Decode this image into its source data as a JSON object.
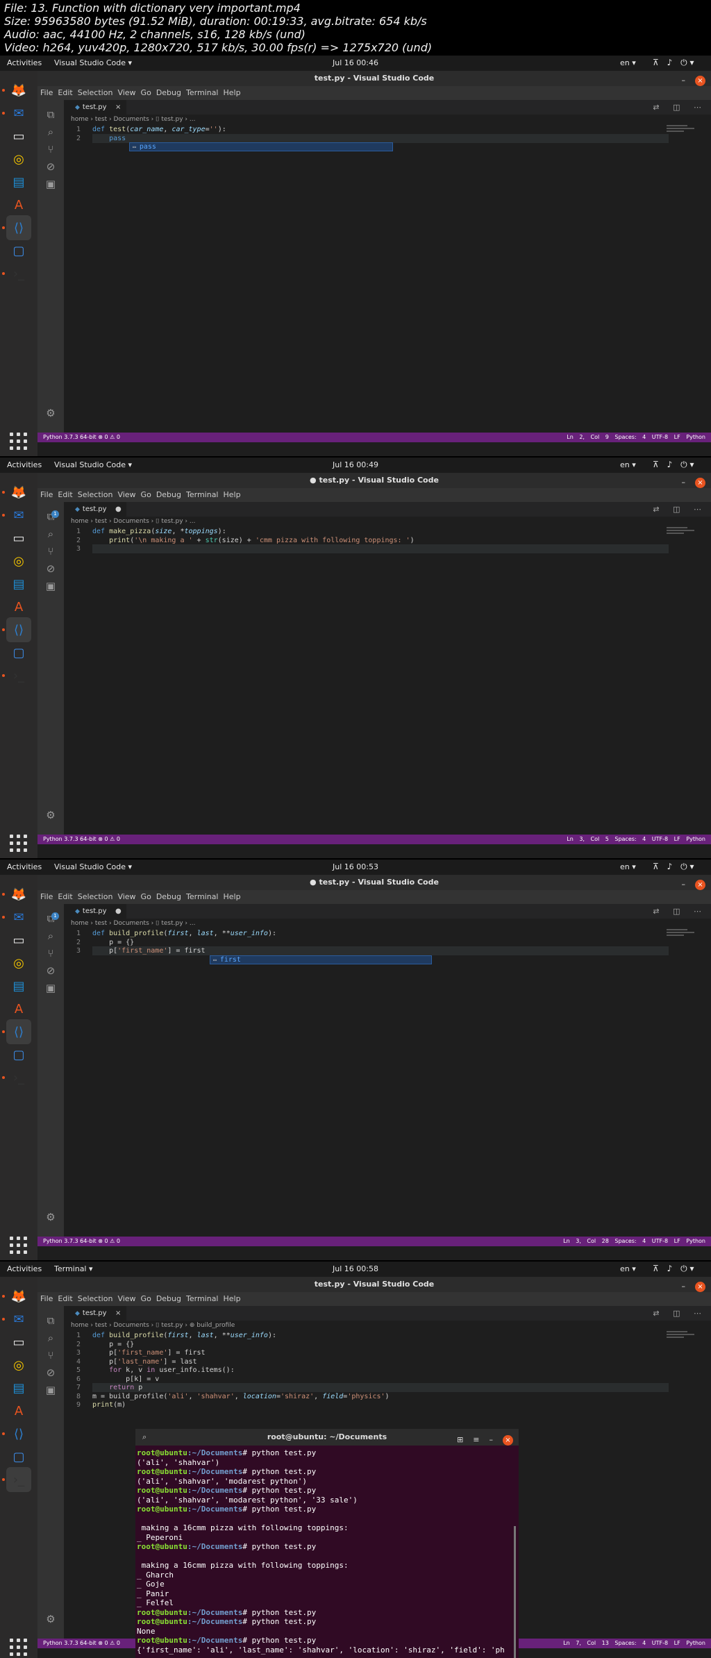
{
  "file_info": [
    "File: 13. Function with dictionary very important.mp4",
    "Size: 95963580 bytes (91.52 MiB), duration: 00:19:33, avg.bitrate: 654 kb/s",
    "Audio: aac, 44100 Hz, 2 channels, s16, 128 kb/s (und)",
    "Video: h264, yuv420p, 1280x720, 517 kb/s, 30.00 fps(r) => 1275x720 (und)"
  ],
  "colors": {
    "accent": "#e95420",
    "statusbar": "#68217a",
    "terminal_bg": "#300a24"
  },
  "menu": [
    "File",
    "Edit",
    "Selection",
    "View",
    "Go",
    "Debug",
    "Terminal",
    "Help"
  ],
  "frames": [
    {
      "activities": "Activities",
      "app": "Visual Studio Code ▾",
      "clock": "Jul 16 00:46",
      "lang": "en ▾",
      "window_title": "test.py - Visual Studio Code",
      "tab": "test.py",
      "tab_mark": "×",
      "breadcrumb": "home › test › Documents › ⌷ test.py › ...",
      "lines": [
        {
          "n": "1",
          "segs": [
            [
              "kw",
              "def "
            ],
            [
              "fn",
              "test"
            ],
            [
              "",
              "("
            ],
            [
              "pm",
              "car_name"
            ],
            [
              "",
              ", "
            ],
            [
              "pm",
              "car_type"
            ],
            [
              "",
              "="
            ],
            [
              "st",
              "''"
            ],
            [
              "",
              "):"
            ]
          ]
        },
        {
          "n": "2",
          "segs": [
            [
              "",
              "    "
            ],
            [
              "kw",
              "pass"
            ]
          ]
        }
      ],
      "suggest": "pass",
      "status_left": "Python 3.7.3 64-bit   ⊗ 0 ⚠ 0",
      "status_right": "Ln 2, Col 9   Spaces: 4   UTF-8   LF   Python"
    },
    {
      "activities": "Activities",
      "app": "Visual Studio Code ▾",
      "clock": "Jul 16 00:49",
      "lang": "en ▾",
      "window_title": "● test.py - Visual Studio Code",
      "tab": "test.py",
      "tab_mark": "●",
      "breadcrumb": "home › test › Documents › ⌷ test.py › ...",
      "lines": [
        {
          "n": "1",
          "segs": [
            [
              "kw",
              "def "
            ],
            [
              "fn",
              "make_pizza"
            ],
            [
              "",
              "("
            ],
            [
              "pm",
              "size"
            ],
            [
              "",
              ", *"
            ],
            [
              "pm",
              "toppings"
            ],
            [
              "",
              "):"
            ]
          ]
        },
        {
          "n": "2",
          "segs": [
            [
              "",
              "    "
            ],
            [
              "fn",
              "print"
            ],
            [
              "",
              "("
            ],
            [
              "st",
              "'\\n making a '"
            ],
            [
              "",
              " + "
            ],
            [
              "bi",
              "str"
            ],
            [
              "",
              "(size) + "
            ],
            [
              "st",
              "'cmm pizza with following toppings: '"
            ],
            [
              "",
              ")"
            ]
          ]
        },
        {
          "n": "3",
          "segs": [
            [
              "",
              ""
            ]
          ]
        }
      ],
      "suggest": "",
      "status_left": "Python 3.7.3 64-bit   ⊗ 0 ⚠ 0",
      "status_right": "Ln 3, Col 5   Spaces: 4   UTF-8   LF   Python"
    },
    {
      "activities": "Activities",
      "app": "Visual Studio Code ▾",
      "clock": "Jul 16 00:53",
      "lang": "en ▾",
      "window_title": "● test.py - Visual Studio Code",
      "tab": "test.py",
      "tab_mark": "●",
      "breadcrumb": "home › test › Documents › ⌷ test.py › ...",
      "lines": [
        {
          "n": "1",
          "segs": [
            [
              "kw",
              "def "
            ],
            [
              "fn",
              "build_profile"
            ],
            [
              "",
              "("
            ],
            [
              "pm",
              "first"
            ],
            [
              "",
              ", "
            ],
            [
              "pm",
              "last"
            ],
            [
              "",
              ", **"
            ],
            [
              "pm",
              "user_info"
            ],
            [
              "",
              "):"
            ]
          ]
        },
        {
          "n": "2",
          "segs": [
            [
              "",
              "    p = {}"
            ]
          ]
        },
        {
          "n": "3",
          "segs": [
            [
              "",
              "    p["
            ],
            [
              "st",
              "'first_name'"
            ],
            [
              "",
              "] = first"
            ]
          ]
        }
      ],
      "suggest": "first",
      "status_left": "Python 3.7.3 64-bit   ⊗ 0 ⚠ 0",
      "status_right": "Ln 3, Col 28   Spaces: 4   UTF-8   LF   Python"
    },
    {
      "activities": "Activities",
      "app": "Terminal ▾",
      "clock": "Jul 16 00:58",
      "lang": "en ▾",
      "window_title": "test.py - Visual Studio Code",
      "tab": "test.py",
      "tab_mark": "×",
      "breadcrumb": "home › test › Documents › ⌷ test.py › ⊕ build_profile",
      "lines": [
        {
          "n": "1",
          "segs": [
            [
              "kw",
              "def "
            ],
            [
              "fn",
              "build_profile"
            ],
            [
              "",
              "("
            ],
            [
              "pm",
              "first"
            ],
            [
              "",
              ", "
            ],
            [
              "pm",
              "last"
            ],
            [
              "",
              ", **"
            ],
            [
              "pm",
              "user_info"
            ],
            [
              "",
              "):"
            ]
          ]
        },
        {
          "n": "2",
          "segs": [
            [
              "",
              "    p = {}"
            ]
          ]
        },
        {
          "n": "3",
          "segs": [
            [
              "",
              "    p["
            ],
            [
              "st",
              "'first_name'"
            ],
            [
              "",
              "] = first"
            ]
          ]
        },
        {
          "n": "4",
          "segs": [
            [
              "",
              "    p["
            ],
            [
              "st",
              "'last_name'"
            ],
            [
              "",
              "] = last"
            ]
          ]
        },
        {
          "n": "5",
          "segs": [
            [
              "",
              "    "
            ],
            [
              "cf",
              "for"
            ],
            [
              "",
              " k, v "
            ],
            [
              "cf",
              "in"
            ],
            [
              "",
              " user_info.items():"
            ]
          ]
        },
        {
          "n": "6",
          "segs": [
            [
              "",
              "        p[k] = v"
            ]
          ]
        },
        {
          "n": "7",
          "segs": [
            [
              "",
              "    "
            ],
            [
              "cf",
              "return"
            ],
            [
              "",
              " p"
            ]
          ]
        },
        {
          "n": "8",
          "segs": [
            [
              "",
              "m = build_profile("
            ],
            [
              "st",
              "'ali'"
            ],
            [
              "",
              ", "
            ],
            [
              "st",
              "'shahvar'"
            ],
            [
              "",
              ", "
            ],
            [
              "pm",
              "location"
            ],
            [
              "",
              "="
            ],
            [
              "st",
              "'shiraz'"
            ],
            [
              "",
              ", "
            ],
            [
              "pm",
              "field"
            ],
            [
              "",
              "="
            ],
            [
              "st",
              "'physics'"
            ],
            [
              "",
              ")"
            ]
          ]
        },
        {
          "n": "9",
          "segs": [
            [
              "fn",
              "print"
            ],
            [
              "",
              "(m)"
            ]
          ]
        }
      ],
      "suggest": "",
      "status_left": "Python 3.7.3 64-bit   ⊗ 0 ⚠ 0",
      "status_right": "Ln 7, Col 13   Spaces: 4   UTF-8   LF   Python"
    }
  ],
  "terminal": {
    "title": "root@ubuntu: ~/Documents",
    "lines": [
      {
        "p": "root@ubuntu",
        "d": ":~/Documents",
        "c": "# python test.py"
      },
      {
        "t": "('ali', 'shahvar')"
      },
      {
        "p": "root@ubuntu",
        "d": ":~/Documents",
        "c": "# python test.py"
      },
      {
        "t": "('ali', 'shahvar', 'modarest python')"
      },
      {
        "p": "root@ubuntu",
        "d": ":~/Documents",
        "c": "# python test.py"
      },
      {
        "t": "('ali', 'shahvar', 'modarest python', '33 sale')"
      },
      {
        "p": "root@ubuntu",
        "d": ":~/Documents",
        "c": "# python test.py"
      },
      {
        "t": ""
      },
      {
        "t": " making a 16cmm pizza with following toppings:"
      },
      {
        "t": "_ Peperoni"
      },
      {
        "p": "root@ubuntu",
        "d": ":~/Documents",
        "c": "# python test.py"
      },
      {
        "t": ""
      },
      {
        "t": " making a 16cmm pizza with following toppings:"
      },
      {
        "t": "_ Gharch"
      },
      {
        "t": "_ Goje"
      },
      {
        "t": "_ Panir"
      },
      {
        "t": "_ Felfel"
      },
      {
        "p": "root@ubuntu",
        "d": ":~/Documents",
        "c": "# python test.py"
      },
      {
        "p": "root@ubuntu",
        "d": ":~/Documents",
        "c": "# python test.py"
      },
      {
        "t": "None"
      },
      {
        "p": "root@ubuntu",
        "d": ":~/Documents",
        "c": "# python test.py"
      },
      {
        "t": "{'first_name': 'ali', 'last_name': 'shahvar', 'location': 'shiraz', 'field': 'ph"
      }
    ]
  }
}
